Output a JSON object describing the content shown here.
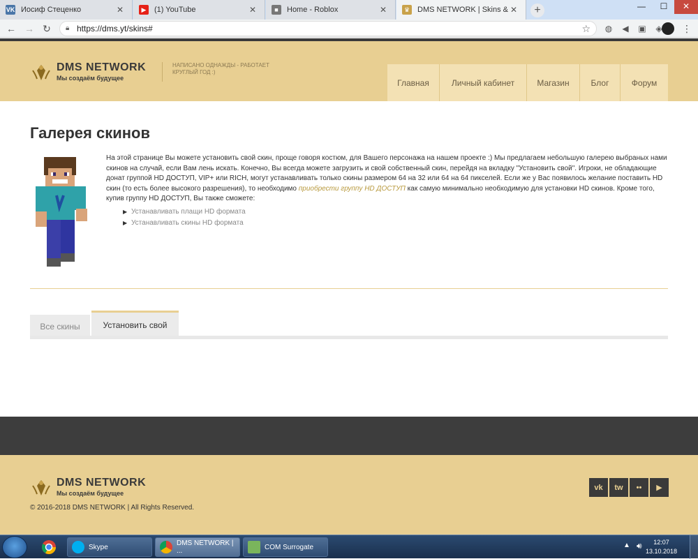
{
  "browser": {
    "tabs": [
      {
        "title": "Иосиф Стеценко",
        "favicon": "vk-icon",
        "active": false
      },
      {
        "title": "(1) YouTube",
        "favicon": "youtube-icon",
        "active": false
      },
      {
        "title": "Home - Roblox",
        "favicon": "roblox-icon",
        "active": false
      },
      {
        "title": "DMS NETWORK | Skins & Cloaks",
        "favicon": "dms-icon",
        "active": true
      }
    ],
    "new_tab": "+",
    "address": "https://dms.yt/skins#",
    "window_controls": {
      "minimize": "—",
      "maximize": "☐",
      "close": "✕"
    }
  },
  "site": {
    "logo_title": "DMS NETWORK",
    "logo_subtitle": "Мы создаём будущее",
    "slogan": "НАПИСАНО ОДНАЖДЫ - РАБОТАЕТ КРУГЛЫЙ ГОД :)",
    "nav": [
      "Главная",
      "Личный кабинет",
      "Магазин",
      "Блог",
      "Форум"
    ]
  },
  "page": {
    "title": "Галерея скинов",
    "intro_before_link": "На этой странице Вы можете установить свой скин, проще говоря костюм, для Вашего персонажа на нашем проекте :) Мы предлагаем небольшую галерею выбраных нами скинов на случай, если Вам лень искать. Конечно, Вы всегда можете загрузить и свой собственный скин, перейдя на вкладку \"Установить свой\". Игроки, не обладающие донат группой HD ДОСТУП, VIP+ или RICH, могут устанавливать только скины размером 64 на 32 или 64 на 64 пикселей. Если же у Вас появилось желание поставить HD скин (то есть более высокого разрешения), то необходимо",
    "intro_link": "приобрести группу HD ДОСТУП",
    "intro_after_link": "как самую минимально необходимую для установки HD скинов. Кроме того, купив группу HD ДОСТУП, Вы также сможете:",
    "features": [
      "Устанавливать плащи HD формата",
      "Устанавливать скины HD формата"
    ],
    "tabs": [
      {
        "label": "Все скины",
        "active": false
      },
      {
        "label": "Установить свой",
        "active": true
      }
    ]
  },
  "footer": {
    "logo_title": "DMS NETWORK",
    "logo_subtitle": "Мы создаём будущее",
    "copyright": "© 2016-2018 DMS NETWORK | All Rights Reserved.",
    "social": [
      {
        "label": "vk",
        "icon": "vk-icon"
      },
      {
        "label": "tw",
        "icon": "twitter-icon"
      },
      {
        "label": "••",
        "icon": "flickr-icon"
      },
      {
        "label": "▶",
        "icon": "youtube-play-icon"
      }
    ]
  },
  "taskbar": {
    "tasks": [
      "Skype",
      "DMS NETWORK | ...",
      "COM Surrogate"
    ],
    "time": "12:07",
    "date": "13.10.2018"
  },
  "colors": {
    "accent": "#e8cf92",
    "dark": "#3d3d3d",
    "link": "#b8993d"
  }
}
